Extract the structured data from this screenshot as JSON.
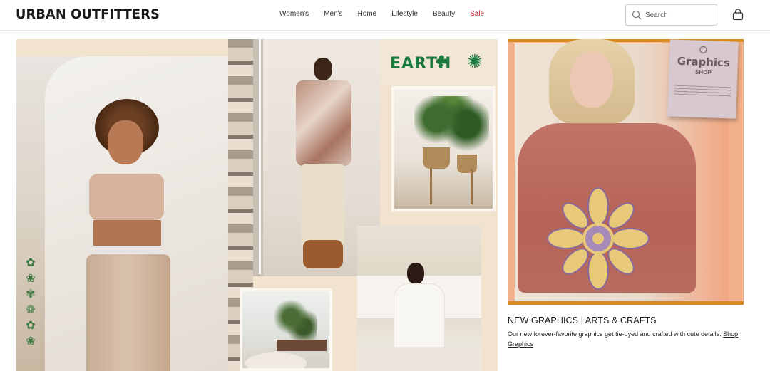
{
  "header": {
    "logo": "URBAN OUTFITTERS",
    "nav": [
      "Women's",
      "Men's",
      "Home",
      "Lifestyle",
      "Beauty",
      "Sale"
    ],
    "search_placeholder": "Search"
  },
  "hero_collage": {
    "sticker_text": "EARTH"
  },
  "feature": {
    "tag_brand": "Graphics",
    "tag_subtitle": "SHOP",
    "title": "NEW GRAPHICS | ARTS & CRAFTS",
    "description": "Our new forever-favorite graphics get tie-dyed and crafted with cute details. ",
    "link_text": "Shop Graphics"
  },
  "colors": {
    "sale": "#c8102e",
    "earth_green": "#1c7a3e",
    "orange_frame": "#f4b28a"
  }
}
